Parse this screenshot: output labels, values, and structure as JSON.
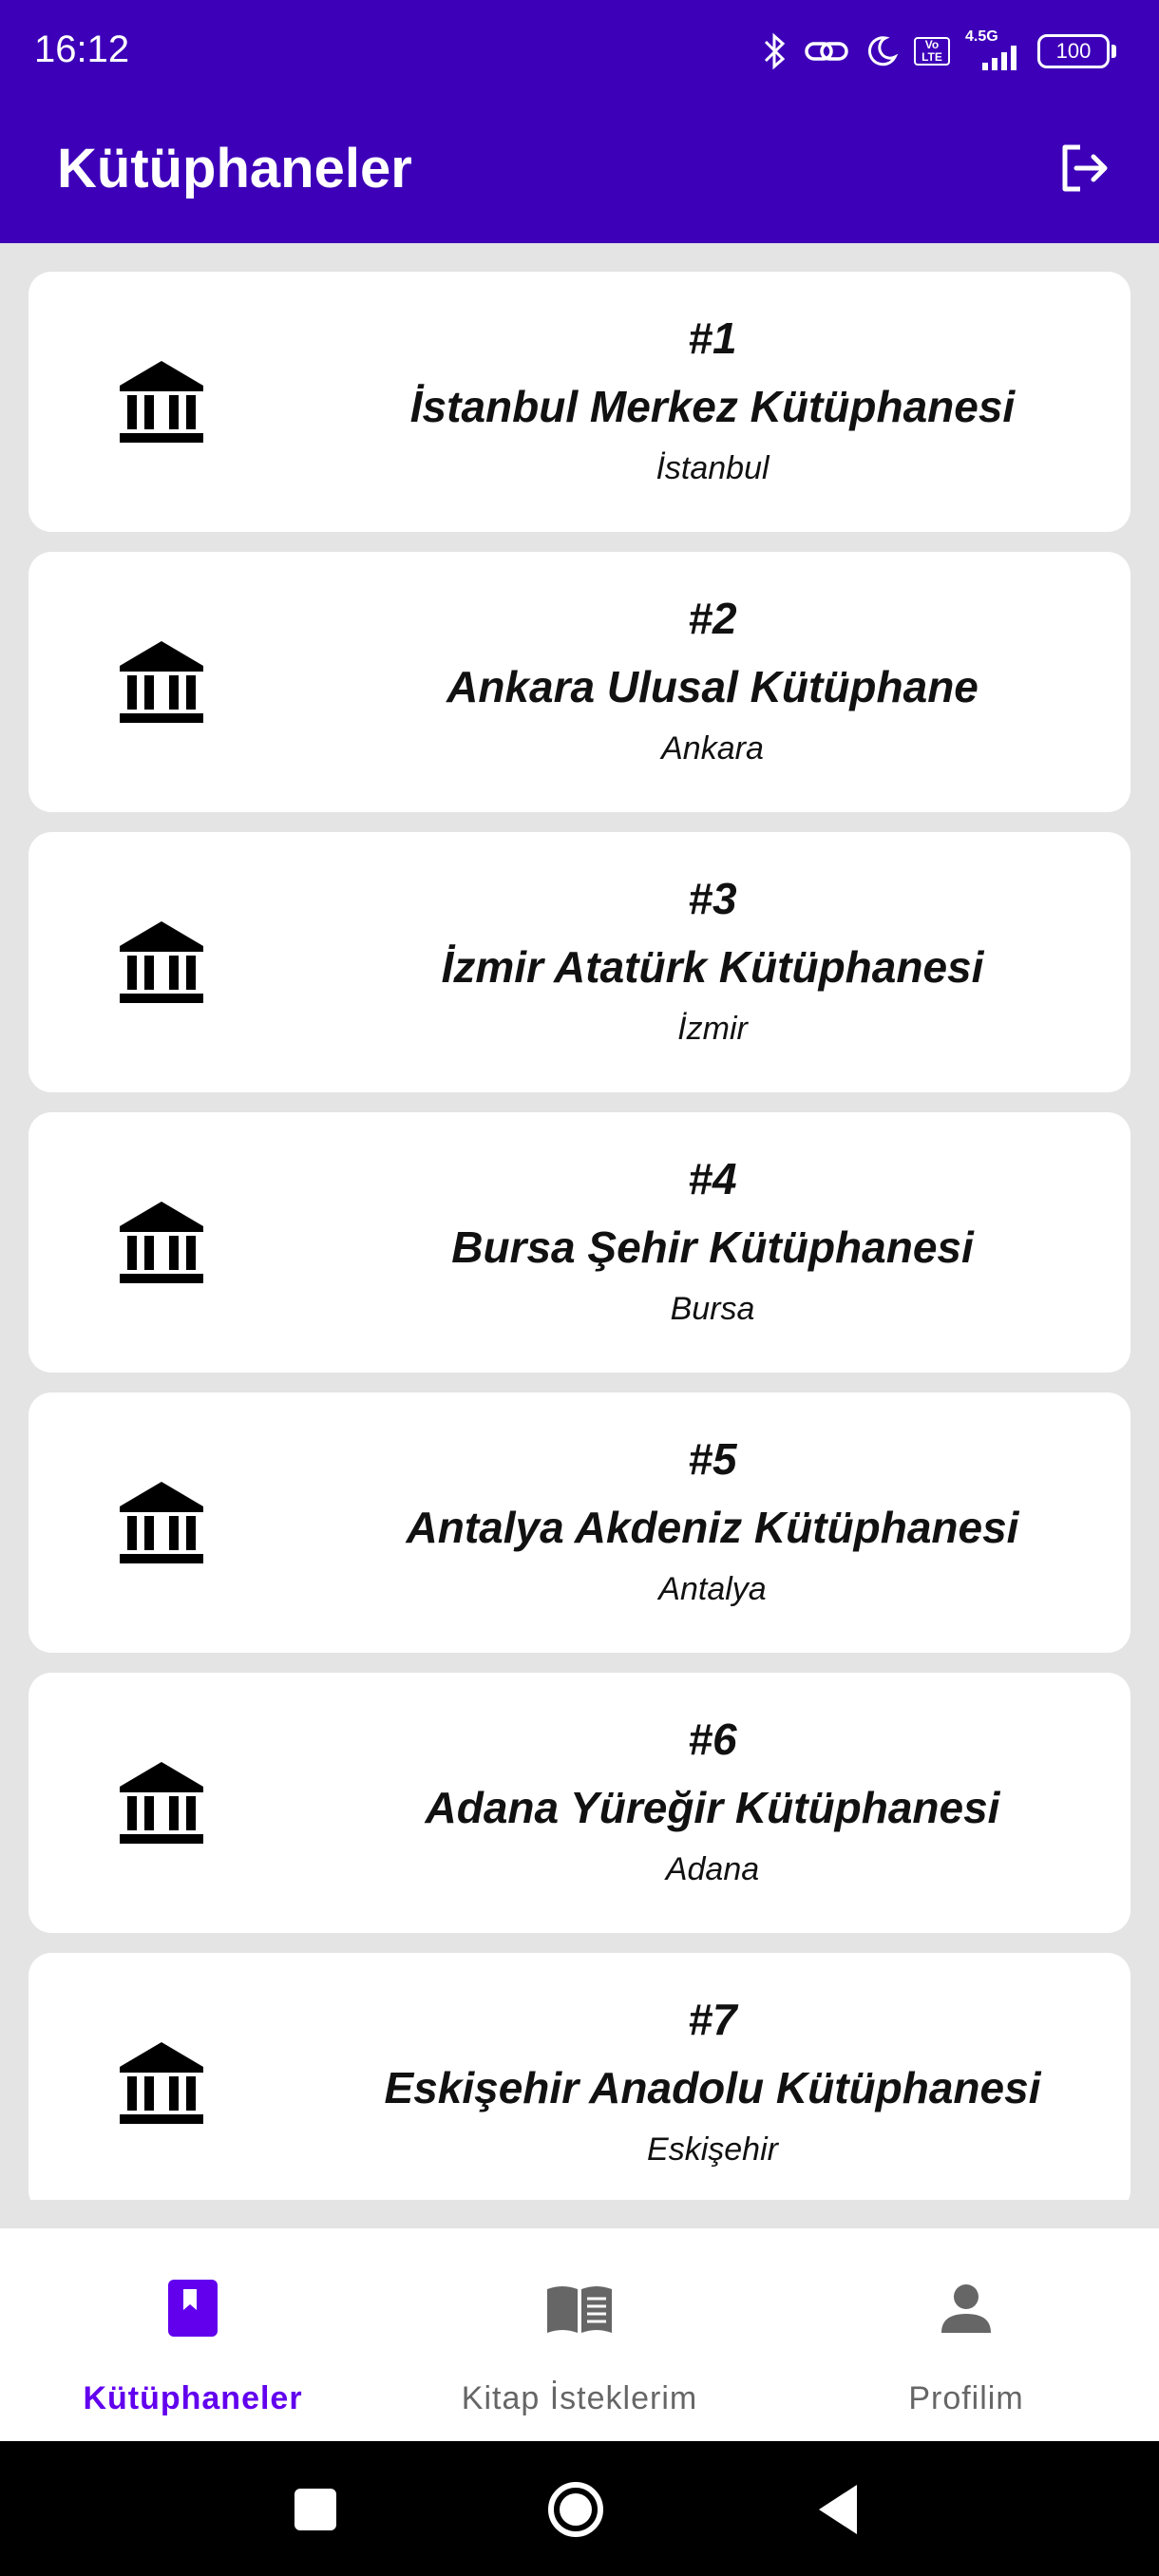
{
  "status_bar": {
    "time": "16:12",
    "network": "4.5G",
    "volte": "Vo LTE",
    "battery": "100"
  },
  "app_bar": {
    "title": "Kütüphaneler",
    "logout_icon": "logout-icon"
  },
  "libraries": [
    {
      "number": "#1",
      "name": "İstanbul Merkez Kütüphanesi",
      "city": "İstanbul"
    },
    {
      "number": "#2",
      "name": "Ankara Ulusal Kütüphane",
      "city": "Ankara"
    },
    {
      "number": "#3",
      "name": "İzmir Atatürk Kütüphanesi",
      "city": "İzmir"
    },
    {
      "number": "#4",
      "name": "Bursa Şehir Kütüphanesi",
      "city": "Bursa"
    },
    {
      "number": "#5",
      "name": "Antalya Akdeniz Kütüphanesi",
      "city": "Antalya"
    },
    {
      "number": "#6",
      "name": "Adana Yüreğir Kütüphanesi",
      "city": "Adana"
    },
    {
      "number": "#7",
      "name": "Eskişehir Anadolu Kütüphanesi",
      "city": "Eskişehir"
    }
  ],
  "bottom_nav": {
    "items": [
      {
        "label": "Kütüphaneler",
        "icon": "book-icon",
        "active": true
      },
      {
        "label": "Kitap İsteklerim",
        "icon": "open-book-icon",
        "active": false
      },
      {
        "label": "Profilim",
        "icon": "person-icon",
        "active": false
      }
    ]
  },
  "colors": {
    "primary": "#3d00b8",
    "accent": "#6200ee",
    "background": "#e4e4e4"
  }
}
